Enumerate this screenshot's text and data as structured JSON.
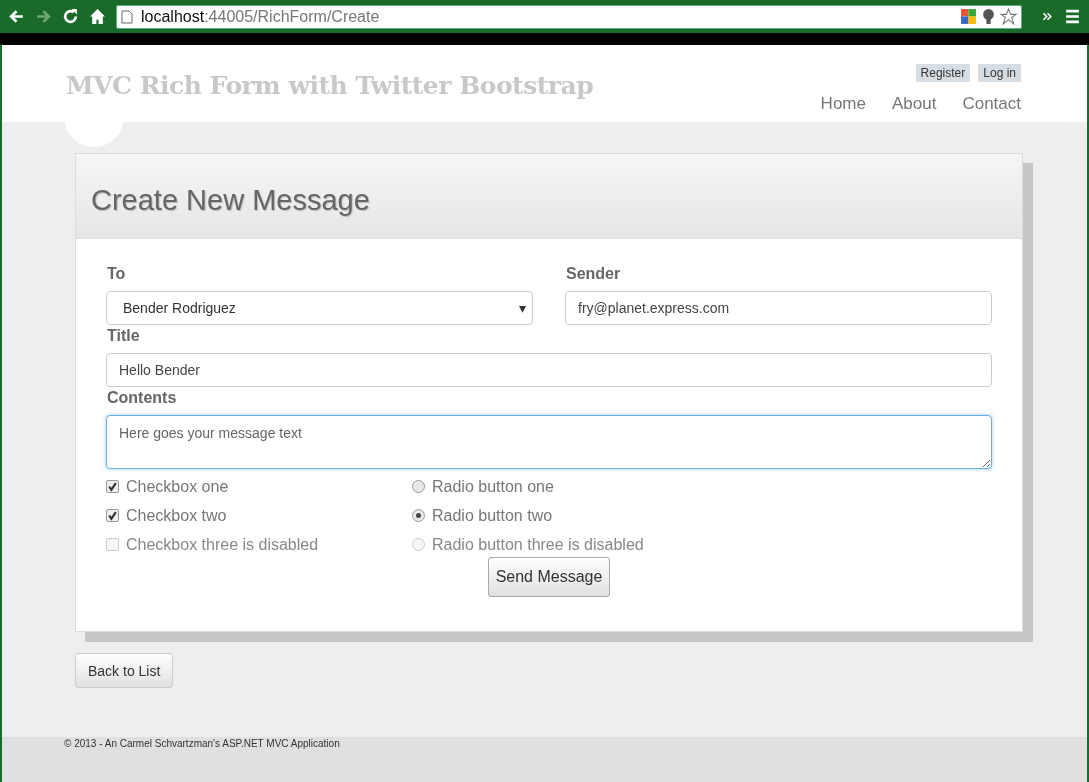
{
  "browser": {
    "url_host": "localhost",
    "url_path": ":44005/RichForm/Create"
  },
  "header": {
    "site_title": "MVC Rich Form with Twitter Bootstrap",
    "account_links": [
      "Register",
      "Log in"
    ],
    "nav": [
      "Home",
      "About",
      "Contact"
    ]
  },
  "form": {
    "heading": "Create New Message",
    "to": {
      "label": "To",
      "value": "Bender Rodriguez",
      "caret": "▾"
    },
    "sender": {
      "label": "Sender",
      "value": "fry@planet.express.com"
    },
    "title": {
      "label": "Title",
      "value": "Hello Bender"
    },
    "contents": {
      "label": "Contents",
      "placeholder": "Here goes your message text",
      "focused": true
    },
    "checkboxes": [
      {
        "label": "Checkbox one",
        "checked": true,
        "disabled": false
      },
      {
        "label": "Checkbox two",
        "checked": true,
        "disabled": false
      },
      {
        "label": "Checkbox three is disabled",
        "checked": false,
        "disabled": true
      }
    ],
    "radios": [
      {
        "label": "Radio button one",
        "selected": false,
        "disabled": false
      },
      {
        "label": "Radio button two",
        "selected": true,
        "disabled": false
      },
      {
        "label": "Radio button three is disabled",
        "selected": false,
        "disabled": true
      }
    ],
    "submit": "Send Message"
  },
  "back_button": "Back to List",
  "footer": "© 2013 - An Carmel Schvartzman's ASP.NET MVC Application"
}
